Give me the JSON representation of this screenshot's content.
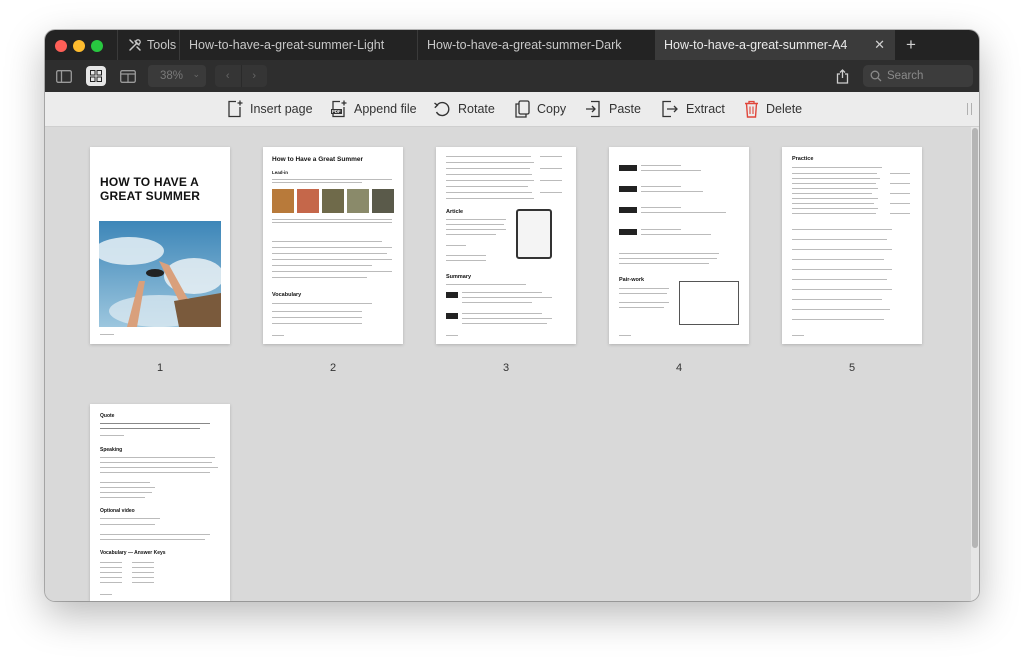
{
  "tabs": {
    "tools": "Tools",
    "light": "How-to-have-a-great-summer-Light",
    "dark": "How-to-have-a-great-summer-Dark",
    "a4": "How-to-have-a-great-summer-A4"
  },
  "toolbar": {
    "zoom": "38%",
    "search_placeholder": "Search"
  },
  "actions": {
    "insert": "Insert page",
    "append": "Append file",
    "rotate": "Rotate",
    "copy": "Copy",
    "paste": "Paste",
    "extract": "Extract",
    "delete": "Delete"
  },
  "pages": {
    "numbers": [
      "1",
      "2",
      "3",
      "4",
      "5"
    ],
    "p1_title_line1": "HOW TO HAVE A",
    "p1_title_line2": "GREAT SUMMER",
    "p2_title": "How to Have a Great Summer",
    "p2_leadin": "Lead-in",
    "p2_vocab": "Vocabulary",
    "p3_article": "Article",
    "p3_summary": "Summary",
    "p4_pairwork": "Pair-work",
    "p5_practice": "Practice",
    "p6_quote": "Quote",
    "p6_speaking": "Speaking",
    "p6_video": "Optional video",
    "p6_answers": "Vocabulary — Answer Keys"
  },
  "colors": {
    "tabbar": "#232323",
    "active_tab": "#3b3b3b",
    "toolbar": "#2e2e2e",
    "actionbar": "#ececec",
    "canvas": "#d9d9d9",
    "delete_red": "#e0453a"
  }
}
